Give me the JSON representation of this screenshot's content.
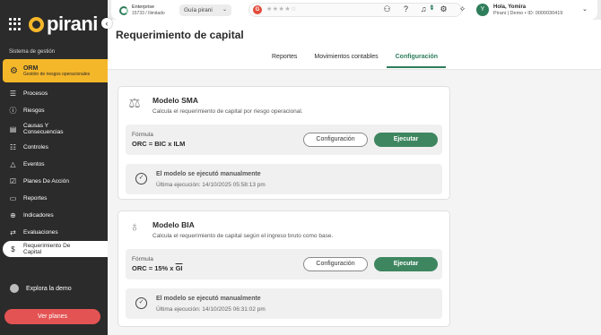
{
  "app": {
    "logo_text": "pirani",
    "section_label": "Sistema de gestión"
  },
  "sidebar": {
    "module": {
      "title": "ORM",
      "subtitle": "Gestión de riesgos operacionales"
    },
    "items": [
      {
        "label": "Procesos",
        "icon": "process-icon"
      },
      {
        "label": "Riesgos",
        "icon": "alert-circle-icon"
      },
      {
        "label": "Causas Y\nConsecuencias",
        "icon": "causes-icon"
      },
      {
        "label": "Controles",
        "icon": "sliders-icon"
      },
      {
        "label": "Eventos",
        "icon": "warning-triangle-icon"
      },
      {
        "label": "Planes De Acción",
        "icon": "checklist-icon"
      },
      {
        "label": "Reportes",
        "icon": "document-icon"
      },
      {
        "label": "Indicadores",
        "icon": "target-icon"
      },
      {
        "label": "Evaluaciones",
        "icon": "shuffle-icon"
      },
      {
        "label": "Requerimiento De\nCapital",
        "icon": "capital-icon"
      }
    ],
    "demo_label": "Explora la demo",
    "plans_button": "Ver planes"
  },
  "topbar": {
    "plan_name": "Enterprise",
    "plan_usage": "15733 / Ilimitado",
    "guide_label": "Guía pirani",
    "rating_stars": "★★★★☆",
    "notification_count": "2",
    "avatar_letter": "Y",
    "user_name": "Hola, Yomira",
    "user_org": "Pirani | Demo • ID: 0000030419"
  },
  "page": {
    "title": "Requerimiento de capital",
    "tabs": [
      {
        "label": "Reportes",
        "active": false
      },
      {
        "label": "Movimientos contables",
        "active": false
      },
      {
        "label": "Configuración",
        "active": true
      }
    ]
  },
  "models": [
    {
      "title": "Modelo SMA",
      "description": "Calcula el requerimiento de capital por riesgo operacional.",
      "formula_label": "Fórmula",
      "formula_value": "ORC = BIC x ILM",
      "config_button": "Configuración",
      "run_button": "Ejecutar",
      "status_title": "El modelo se ejecutó manualmente",
      "status_time": "Última ejecución: 14/10/2025 05:58:13 pm"
    },
    {
      "title": "Modelo BIA",
      "description": "Calcula el requerimiento de capital según el ingreso bruto como base.",
      "formula_label": "Fórmula",
      "formula_prefix": "ORC = 15% x ",
      "formula_overline": "GI",
      "config_button": "Configuración",
      "run_button": "Ejecutar",
      "status_title": "El modelo se ejecutó manualmente",
      "status_time": "Última ejecución: 14/10/2025 06:31:02 pm"
    }
  ],
  "colors": {
    "sidebar_bg": "#2b2b2b",
    "brand_yellow": "#f5b72a",
    "accent_green": "#3e8660",
    "plans_red": "#e45353"
  }
}
